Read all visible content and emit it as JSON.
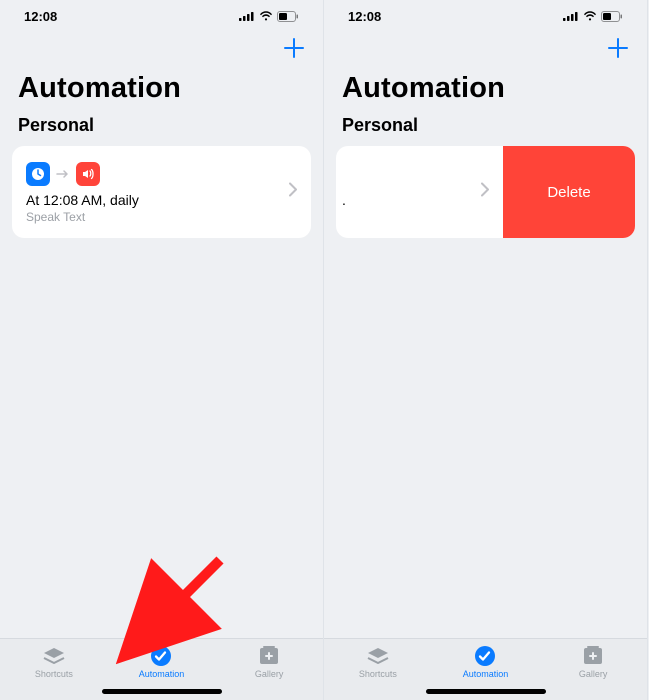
{
  "status": {
    "time": "12:08"
  },
  "page": {
    "title": "Automation",
    "section": "Personal"
  },
  "actions": {
    "add": "+",
    "delete": "Delete"
  },
  "automation": {
    "trigger": "At 12:08 AM, daily",
    "action": "Speak Text"
  },
  "tabs": {
    "shortcuts": "Shortcuts",
    "automation": "Automation",
    "gallery": "Gallery"
  },
  "colors": {
    "accent": "#0a7bff",
    "danger": "#ff4438"
  }
}
